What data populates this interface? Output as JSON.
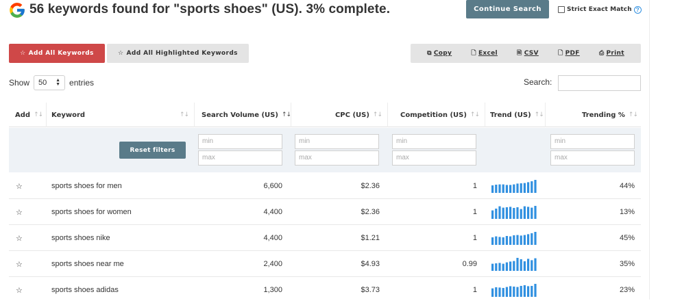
{
  "header": {
    "title": "56 keywords found for \"sports shoes\" (US). 3% complete.",
    "continue_label": "Continue Search",
    "strict_label": "Strict Exact Match",
    "help_glyph": "?"
  },
  "colors": {
    "primary": "#5a7b89",
    "danger": "#cf4848",
    "trend_bar": "#2f8fe0",
    "filter_bg": "#eef2f6"
  },
  "actions": {
    "add_all_label": "Add All Keywords",
    "add_highlighted_label": "Add All Highlighted Keywords"
  },
  "export": [
    {
      "label": "Copy",
      "icon": "copy-icon"
    },
    {
      "label": "Excel",
      "icon": "file-icon"
    },
    {
      "label": "CSV",
      "icon": "file-text-icon"
    },
    {
      "label": "PDF",
      "icon": "file-icon"
    },
    {
      "label": "Print",
      "icon": "print-icon"
    }
  ],
  "table_controls": {
    "show_label": "Show",
    "entries_value": "50",
    "entries_label": "entries",
    "search_label": "Search:",
    "search_value": ""
  },
  "columns": {
    "add": "Add",
    "keyword": "Keyword",
    "volume": "Search Volume (US)",
    "cpc": "CPC (US)",
    "competition": "Competition (US)",
    "trend": "Trend (US)",
    "trending": "Trending %"
  },
  "filters": {
    "reset_label": "Reset filters",
    "min_placeholder": "min",
    "max_placeholder": "max"
  },
  "rows": [
    {
      "keyword": "sports shoes for men",
      "volume": "6,600",
      "cpc": "$2.36",
      "competition": "1",
      "trending": "44%",
      "trend": [
        0.55,
        0.6,
        0.62,
        0.62,
        0.58,
        0.58,
        0.62,
        0.68,
        0.7,
        0.72,
        0.78,
        0.85,
        0.95
      ]
    },
    {
      "keyword": "sports shoes for women",
      "volume": "4,400",
      "cpc": "$2.36",
      "competition": "1",
      "trending": "13%",
      "trend": [
        0.62,
        0.75,
        0.92,
        0.82,
        0.85,
        0.88,
        0.8,
        0.85,
        0.72,
        0.92,
        0.88,
        0.82,
        0.95
      ]
    },
    {
      "keyword": "sports shoes nike",
      "volume": "4,400",
      "cpc": "$1.21",
      "competition": "1",
      "trending": "45%",
      "trend": [
        0.55,
        0.62,
        0.58,
        0.55,
        0.65,
        0.62,
        0.7,
        0.72,
        0.68,
        0.72,
        0.78,
        0.85,
        0.95
      ]
    },
    {
      "keyword": "sports shoes near me",
      "volume": "2,400",
      "cpc": "$4.93",
      "competition": "0.99",
      "trending": "35%",
      "trend": [
        0.52,
        0.55,
        0.58,
        0.52,
        0.62,
        0.68,
        0.72,
        0.95,
        0.85,
        0.7,
        0.88,
        0.78,
        0.92
      ]
    },
    {
      "keyword": "sports shoes adidas",
      "volume": "1,300",
      "cpc": "$3.73",
      "competition": "1",
      "trending": "23%",
      "trend": [
        0.62,
        0.7,
        0.68,
        0.65,
        0.72,
        0.78,
        0.75,
        0.72,
        0.8,
        0.85,
        0.78,
        0.8,
        0.95
      ]
    }
  ]
}
